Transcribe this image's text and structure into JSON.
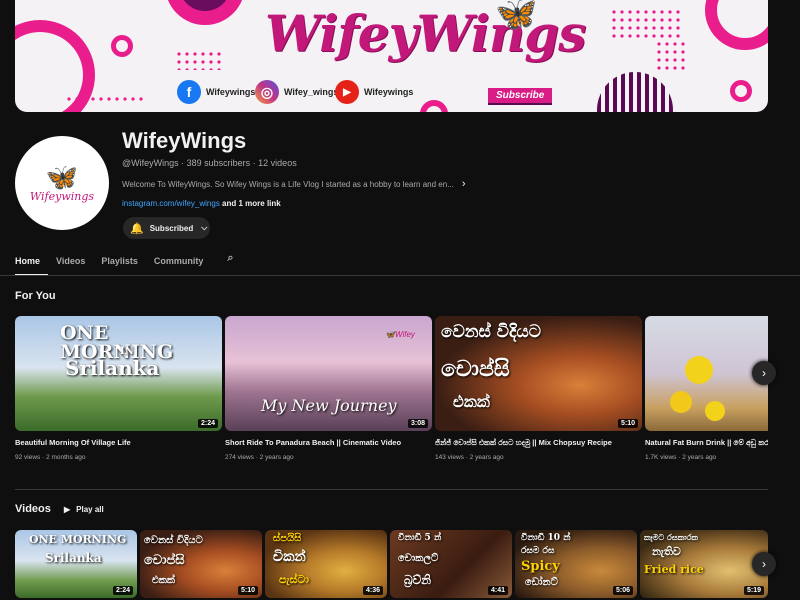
{
  "banner": {
    "title": "WifeyWings",
    "subscribe_tag": "Subscribe",
    "socials": [
      {
        "icon": "facebook-icon",
        "glyph": "f",
        "label": "Wifeywings",
        "color": "#1877f2"
      },
      {
        "icon": "instagram-icon",
        "glyph": "◎",
        "label": "Wifey_wings",
        "color": "#c13584"
      },
      {
        "icon": "youtube-icon",
        "glyph": "▶",
        "label": "Wifeywings",
        "color": "#e62117"
      }
    ]
  },
  "channel": {
    "avatar_text": "Wifeywings",
    "name": "WifeyWings",
    "meta": "@WifeyWings · 389 subscribers · 12 videos",
    "description": "Welcome To WifeyWings. So Wifey Wings is a Life Vlog I started as a hobby to learn and en...",
    "link": "instagram.com/wifey_wings",
    "link_more": "and 1 more link",
    "subscribed_label": "Subscribed"
  },
  "tabs": [
    "Home",
    "Videos",
    "Playlists",
    "Community"
  ],
  "for_you": {
    "title": "For You",
    "videos": [
      {
        "title": "Beautiful Morning Of Village Life",
        "meta": "92 views · 2 months ago",
        "duration": "2:24",
        "overlay": "ONE MORNING\nIN\nSrilanka",
        "progress": 0.0
      },
      {
        "title": "Short Ride To Panadura Beach || Cinematic Video",
        "meta": "274 views · 2 years ago",
        "duration": "3:08",
        "overlay": "My New Journey",
        "progress": 0.0
      },
      {
        "title": "ජින්ජ් චොප්සි එකක් රසට හදමු || Mix Chopsuy Recipe",
        "meta": "143 views · 2 years ago",
        "duration": "5:10",
        "overlay": "වෙනස් විදියට\nචොප්සි\nඑකක්",
        "progress": 0.0
      },
      {
        "title": "Natural Fat Burn Drink || මේ අඩු කර",
        "meta": "1.7K views · 2 years ago",
        "duration": "",
        "overlay": "",
        "progress": 0.0
      }
    ]
  },
  "videos_section": {
    "title": "Videos",
    "play_all": "Play all",
    "videos": [
      {
        "duration": "2:24",
        "overlay": "ONE MORNING\nIN\nSrilanka"
      },
      {
        "duration": "5:10",
        "overlay": "වෙනස් විදියට\nචොප්සි\nඑකක්"
      },
      {
        "duration": "4:36",
        "overlay": "ස්පයිසි\nචිකන්\nපැස්ටා"
      },
      {
        "duration": "4:41",
        "overlay": "විනාඩි 5 න්\nචොකලට්\nබ්‍රව්නි"
      },
      {
        "duration": "5:06",
        "overlay": "විනාඩි 10 න්\nරසම රස\nSpicy\nඩෝනට්"
      },
      {
        "duration": "5:19",
        "overlay": "කෑමට රසකාරක\nනැතිව\nFried rice"
      }
    ]
  },
  "colors": {
    "background": "#0f0f0f",
    "accent": "#e91e8c",
    "link": "#3ea6ff"
  }
}
